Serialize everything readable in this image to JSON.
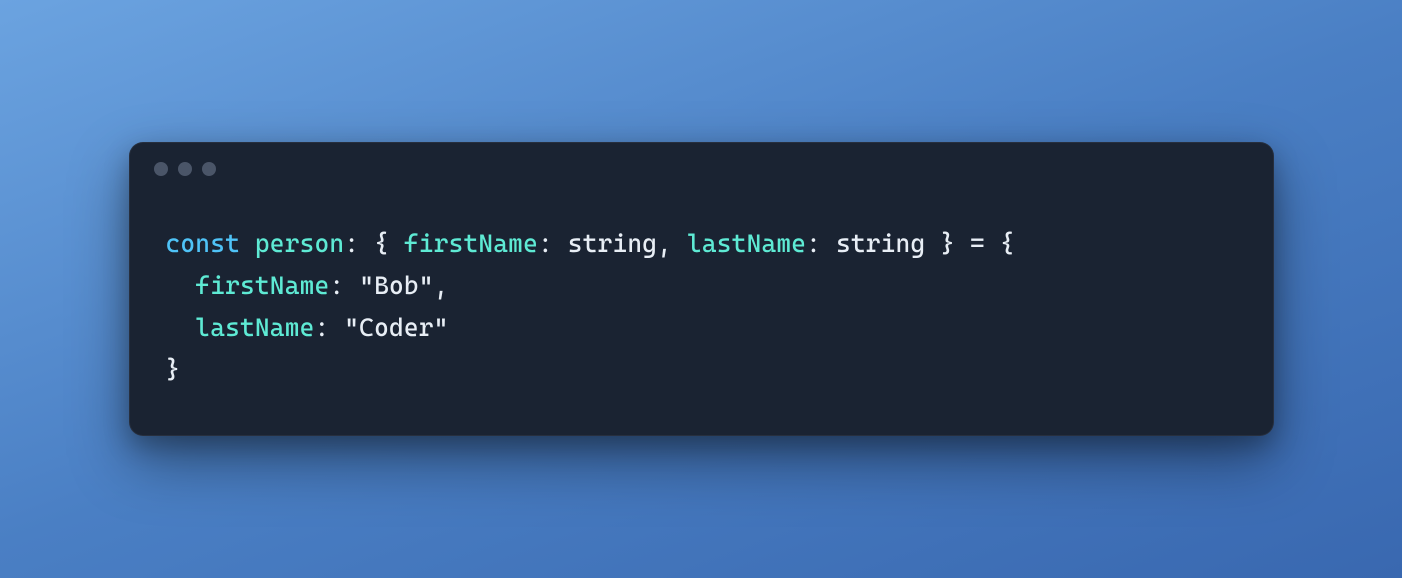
{
  "code": {
    "line1": {
      "keyword": "const",
      "space1": " ",
      "ident": "person",
      "colon1": ": ",
      "brace_open": "{ ",
      "prop1": "firstName",
      "colon2": ": ",
      "type1": "string",
      "comma": ", ",
      "prop2": "lastName",
      "colon3": ": ",
      "type2": "string",
      "brace_close": " }",
      "equals": " = ",
      "obj_open": "{"
    },
    "line2": {
      "indent": "  ",
      "prop": "firstName",
      "colon": ": ",
      "string": "\"Bob\"",
      "comma": ","
    },
    "line3": {
      "indent": "  ",
      "prop": "lastName",
      "colon": ": ",
      "string": "\"Coder\""
    },
    "line4": {
      "close": "}"
    }
  }
}
